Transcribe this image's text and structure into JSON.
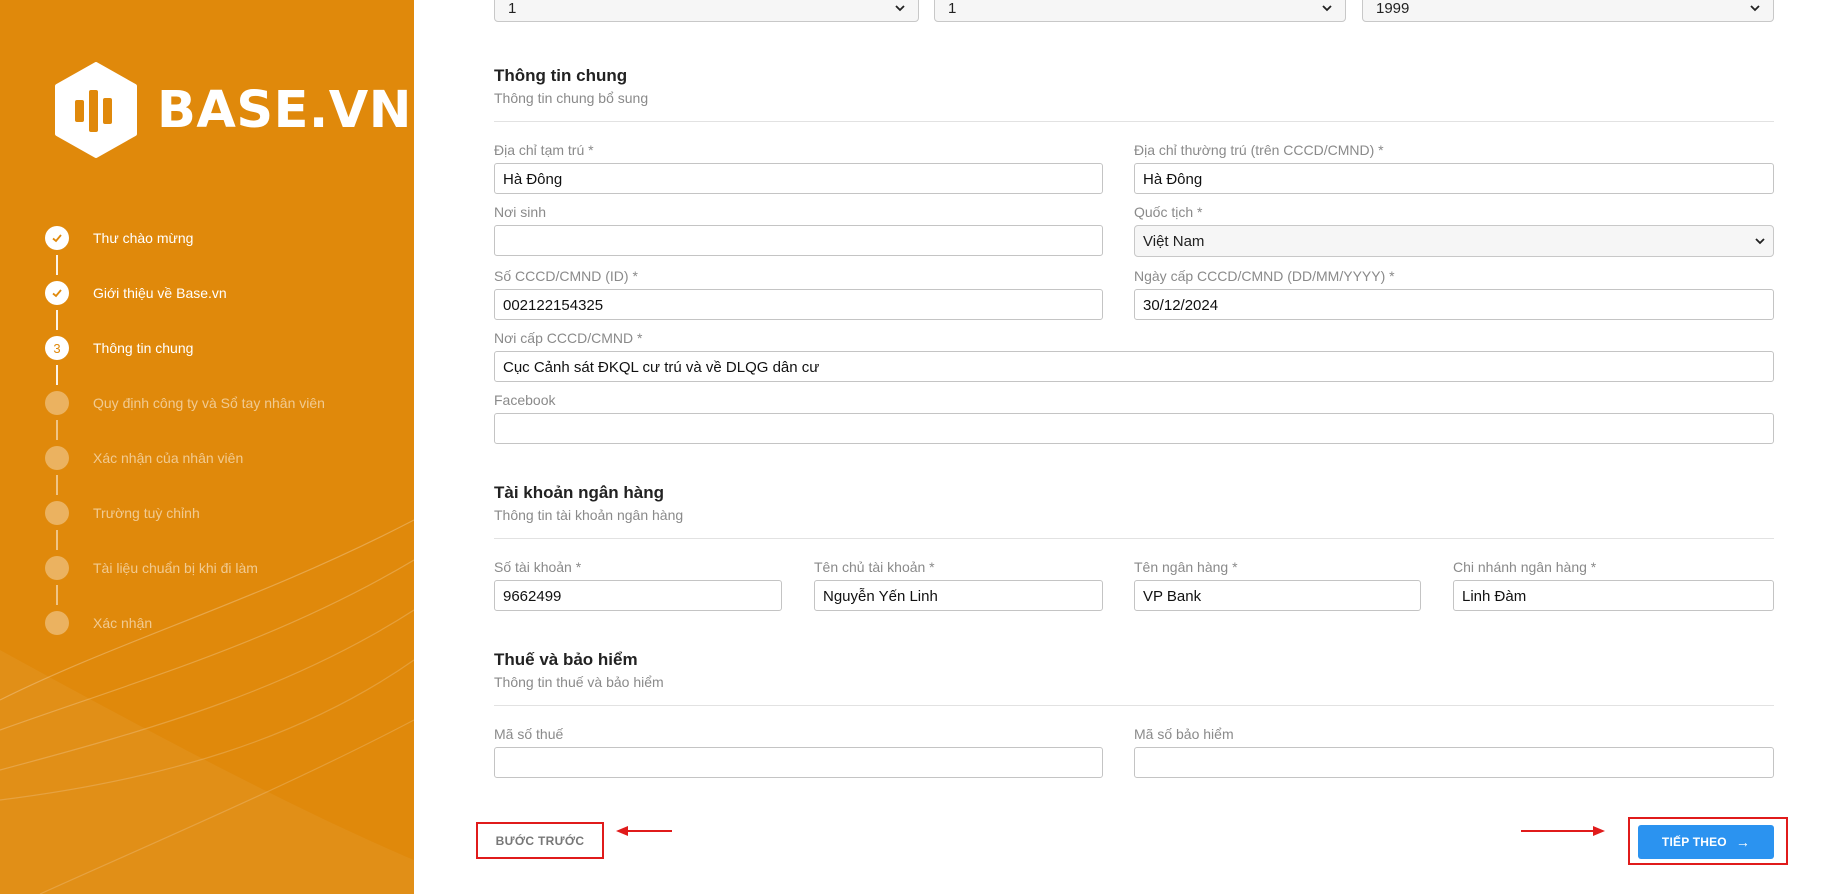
{
  "brand": {
    "name": "BASE.VN"
  },
  "sidebar": {
    "steps": [
      {
        "index": "",
        "label": "Thư chào mừng",
        "state": "done"
      },
      {
        "index": "",
        "label": "Giới thiệu về Base.vn",
        "state": "done"
      },
      {
        "index": "3",
        "label": "Thông tin chung",
        "state": "current"
      },
      {
        "index": "",
        "label": "Quy định công ty và Sổ tay nhân viên",
        "state": "todo"
      },
      {
        "index": "",
        "label": "Xác nhận của nhân viên",
        "state": "todo"
      },
      {
        "index": "",
        "label": "Trường tuỳ chỉnh",
        "state": "todo"
      },
      {
        "index": "",
        "label": "Tài liệu chuẩn bị khi đi làm",
        "state": "todo"
      },
      {
        "index": "",
        "label": "Xác nhận",
        "state": "todo"
      }
    ]
  },
  "dob": {
    "day": "1",
    "month": "1",
    "year": "1999"
  },
  "general": {
    "title": "Thông tin chung",
    "subtitle": "Thông tin chung bổ sung",
    "temp_address": {
      "label": "Địa chỉ tạm trú *",
      "value": "Hà Đông"
    },
    "perm_address": {
      "label": "Địa chỉ thường trú (trên CCCD/CMND) *",
      "value": "Hà Đông"
    },
    "birthplace": {
      "label": "Nơi sinh",
      "value": ""
    },
    "nationality": {
      "label": "Quốc tịch *",
      "value": "Việt Nam"
    },
    "id_number": {
      "label": "Số CCCD/CMND (ID) *",
      "value": "002122154325"
    },
    "id_date": {
      "label": "Ngày cấp CCCD/CMND (DD/MM/YYYY) *",
      "value": "30/12/2024"
    },
    "id_place": {
      "label": "Nơi cấp CCCD/CMND *",
      "value": "Cục Cảnh sát ĐKQL cư trú và về DLQG dân cư"
    },
    "facebook": {
      "label": "Facebook",
      "value": ""
    }
  },
  "bank": {
    "title": "Tài khoản ngân hàng",
    "subtitle": "Thông tin tài khoản ngân hàng",
    "account_no": {
      "label": "Số tài khoản *",
      "value": "9662499"
    },
    "holder": {
      "label": "Tên chủ tài khoản *",
      "value": "Nguyễn Yến Linh"
    },
    "bank_name": {
      "label": "Tên ngân hàng *",
      "value": "VP Bank"
    },
    "branch": {
      "label": "Chi nhánh ngân hàng *",
      "value": "Linh Đàm"
    }
  },
  "tax": {
    "title": "Thuế và bảo hiểm",
    "subtitle": "Thông tin thuế và bảo hiểm",
    "tax_code": {
      "label": "Mã số thuế",
      "value": ""
    },
    "insurance_code": {
      "label": "Mã số bảo hiểm",
      "value": ""
    }
  },
  "nav": {
    "prev_label": "BƯỚC TRƯỚC",
    "next_label": "TIẾP THEO"
  },
  "colors": {
    "sidebar": "#e0890b",
    "primary": "#2b93f0",
    "annotation": "#e01b1b"
  }
}
